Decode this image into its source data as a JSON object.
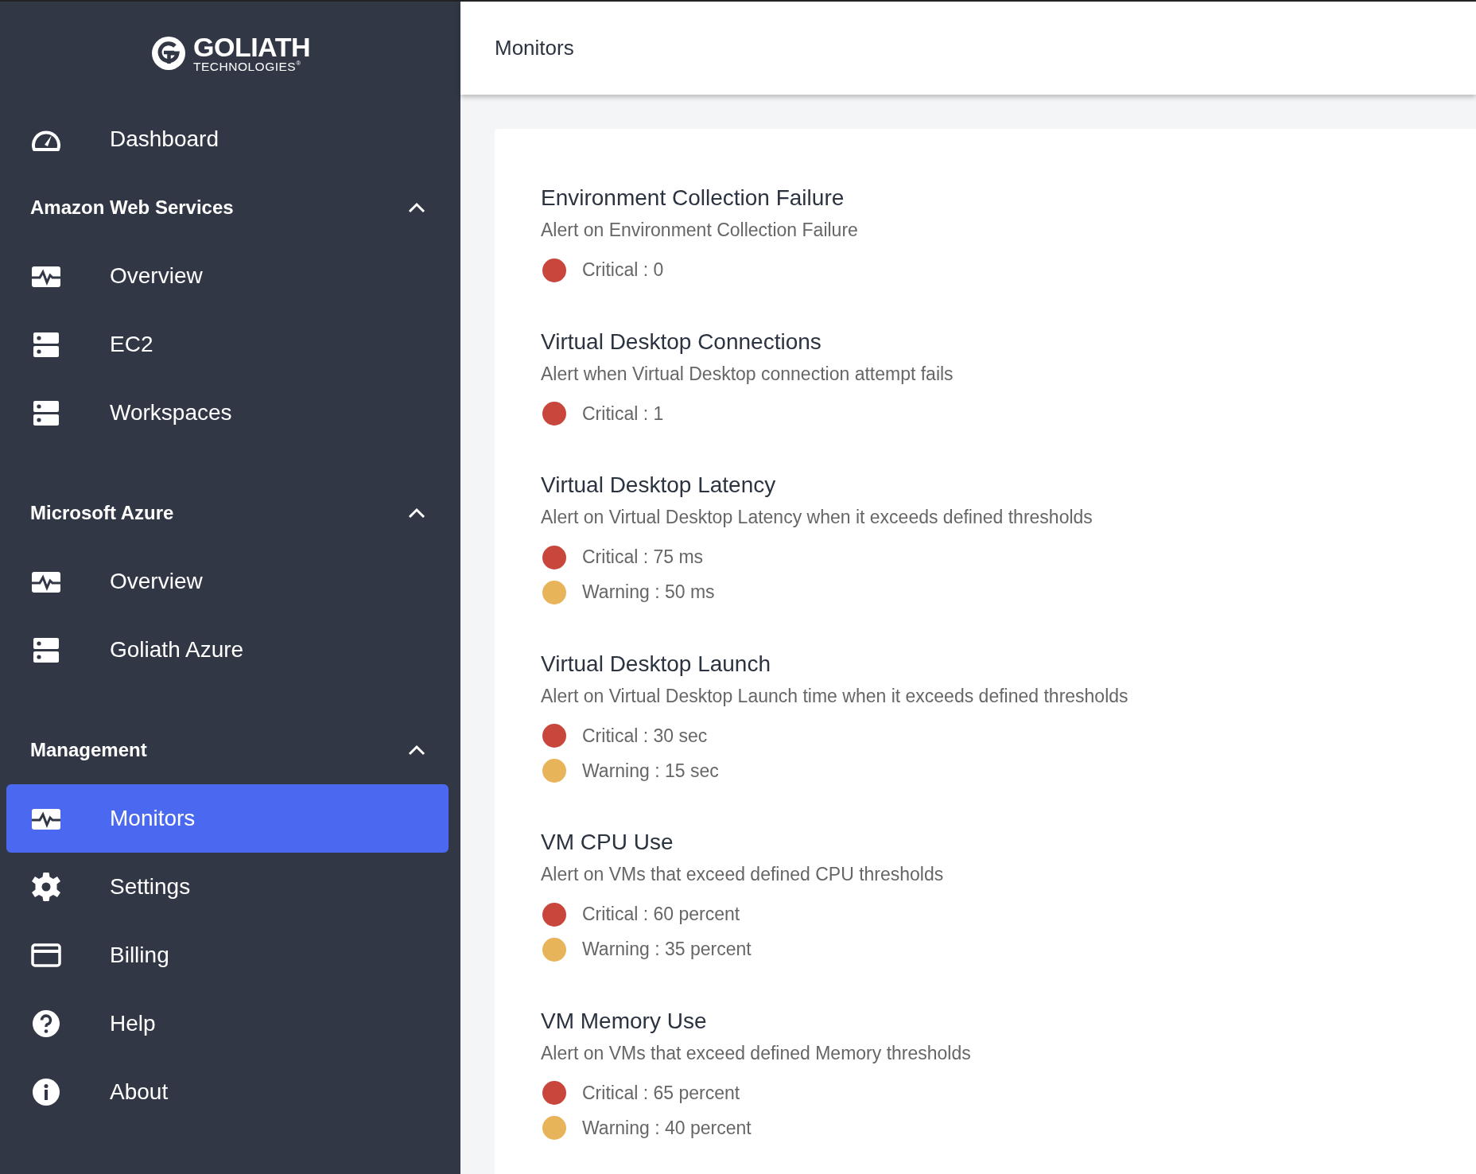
{
  "logo": {
    "name": "GOLIATH",
    "tagline": "TECHNOLOGIES",
    "mark": "®"
  },
  "sidebar": {
    "items": [
      {
        "kind": "link",
        "label": "Dashboard",
        "selected": false
      },
      {
        "kind": "section",
        "label": "Amazon Web Services",
        "expanded": true,
        "children": [
          {
            "kind": "link",
            "label": "Overview",
            "selected": false
          },
          {
            "kind": "link",
            "label": "EC2",
            "selected": false
          },
          {
            "kind": "link",
            "label": "Workspaces",
            "selected": false
          }
        ]
      },
      {
        "kind": "section",
        "label": "Microsoft Azure",
        "expanded": true,
        "children": [
          {
            "kind": "link",
            "label": "Overview",
            "selected": false
          },
          {
            "kind": "link",
            "label": "Goliath Azure",
            "selected": false
          }
        ]
      },
      {
        "kind": "section",
        "label": "Management",
        "expanded": true,
        "children": [
          {
            "kind": "link",
            "label": "Monitors",
            "selected": true
          },
          {
            "kind": "link",
            "label": "Settings",
            "selected": false
          },
          {
            "kind": "link",
            "label": "Billing",
            "selected": false
          },
          {
            "kind": "link",
            "label": "Help",
            "selected": false
          },
          {
            "kind": "link",
            "label": "About",
            "selected": false
          }
        ]
      }
    ]
  },
  "header": {
    "title": "Monitors"
  },
  "monitors": [
    {
      "title": "Environment Collection Failure",
      "description": "Alert on Environment Collection Failure",
      "thresholds": [
        {
          "text": "Critical : 0",
          "color": "#c9463d"
        }
      ]
    },
    {
      "title": "Virtual Desktop Connections",
      "description": "Alert when Virtual Desktop connection attempt fails",
      "thresholds": [
        {
          "text": "Critical : 1",
          "color": "#c9463d"
        }
      ]
    },
    {
      "title": "Virtual Desktop Latency",
      "description": "Alert on Virtual Desktop Latency when it exceeds defined thresholds",
      "thresholds": [
        {
          "text": "Critical : 75 ms",
          "color": "#c9463d"
        },
        {
          "text": "Warning : 50 ms",
          "color": "#e8b45a"
        }
      ]
    },
    {
      "title": "Virtual Desktop Launch",
      "description": "Alert on Virtual Desktop Launch time when it exceeds defined thresholds",
      "thresholds": [
        {
          "text": "Critical : 30 sec",
          "color": "#c9463d"
        },
        {
          "text": "Warning : 15 sec",
          "color": "#e8b45a"
        }
      ]
    },
    {
      "title": "VM CPU Use",
      "description": "Alert on VMs that exceed defined CPU thresholds",
      "thresholds": [
        {
          "text": "Critical : 60 percent",
          "color": "#c9463d"
        },
        {
          "text": "Warning : 35 percent",
          "color": "#e8b45a"
        }
      ]
    },
    {
      "title": "VM Memory Use",
      "description": "Alert on VMs that exceed defined Memory thresholds",
      "thresholds": [
        {
          "text": "Critical : 65 percent",
          "color": "#c9463d"
        },
        {
          "text": "Warning : 40 percent",
          "color": "#e8b45a"
        }
      ]
    }
  ]
}
